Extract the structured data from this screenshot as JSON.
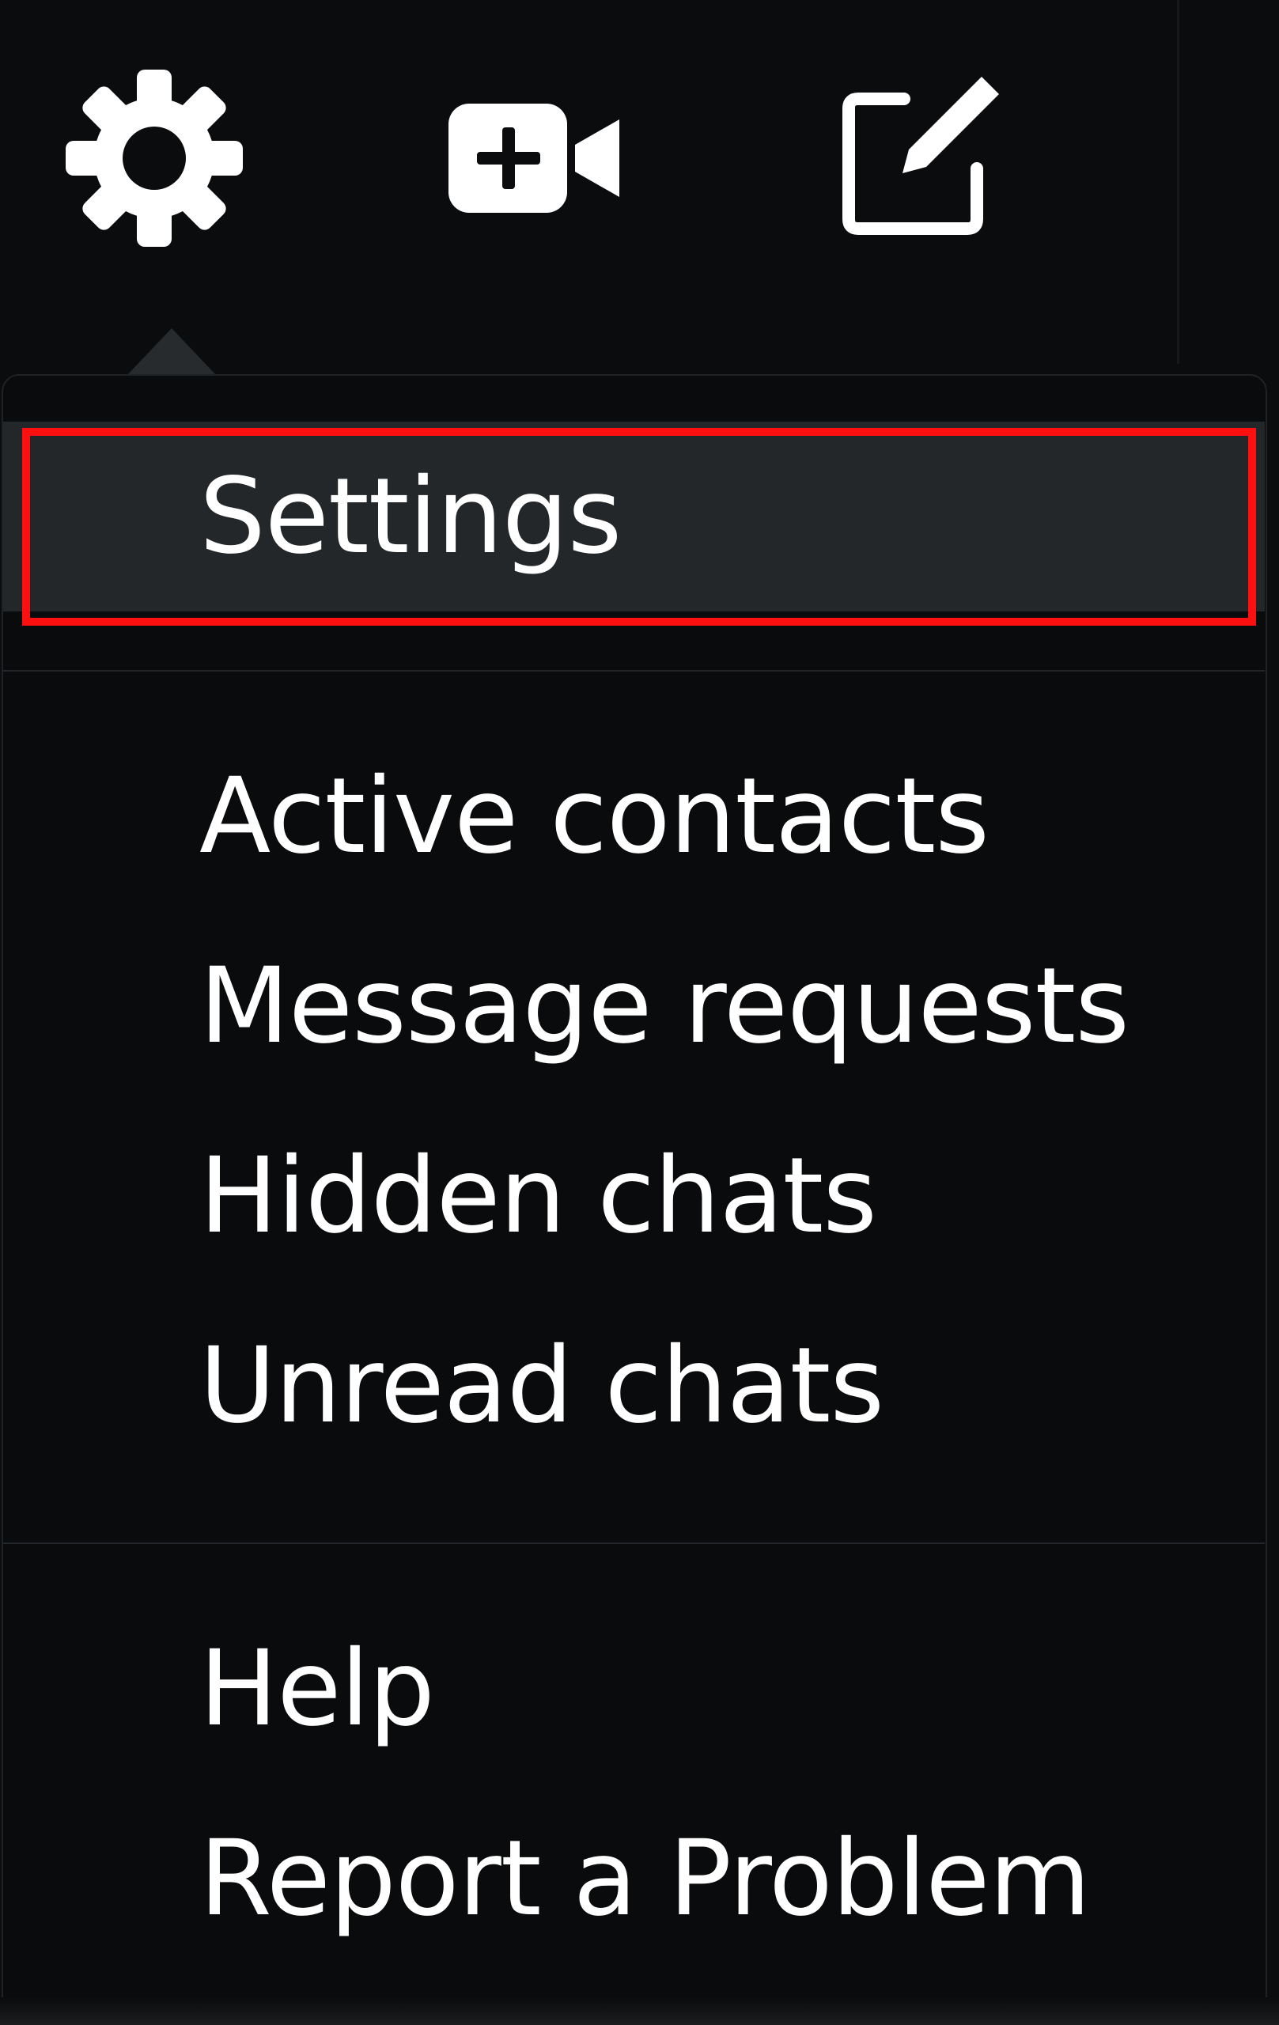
{
  "toolbar": {
    "icons": {
      "settings": "gear-icon",
      "video": "video-plus-icon",
      "compose": "compose-icon"
    }
  },
  "menu": {
    "items": [
      {
        "label": "Settings",
        "active": true
      },
      {
        "label": "Active contacts"
      },
      {
        "label": "Message requests"
      },
      {
        "label": "Hidden chats"
      },
      {
        "label": "Unread chats"
      },
      {
        "label": "Help"
      },
      {
        "label": "Report a Problem"
      }
    ]
  },
  "colors": {
    "background": "#0b0c0d",
    "menu_background": "#0a0b0c",
    "active_item": "#23272a",
    "highlight_border": "#ff1010",
    "text": "#ffffff"
  }
}
